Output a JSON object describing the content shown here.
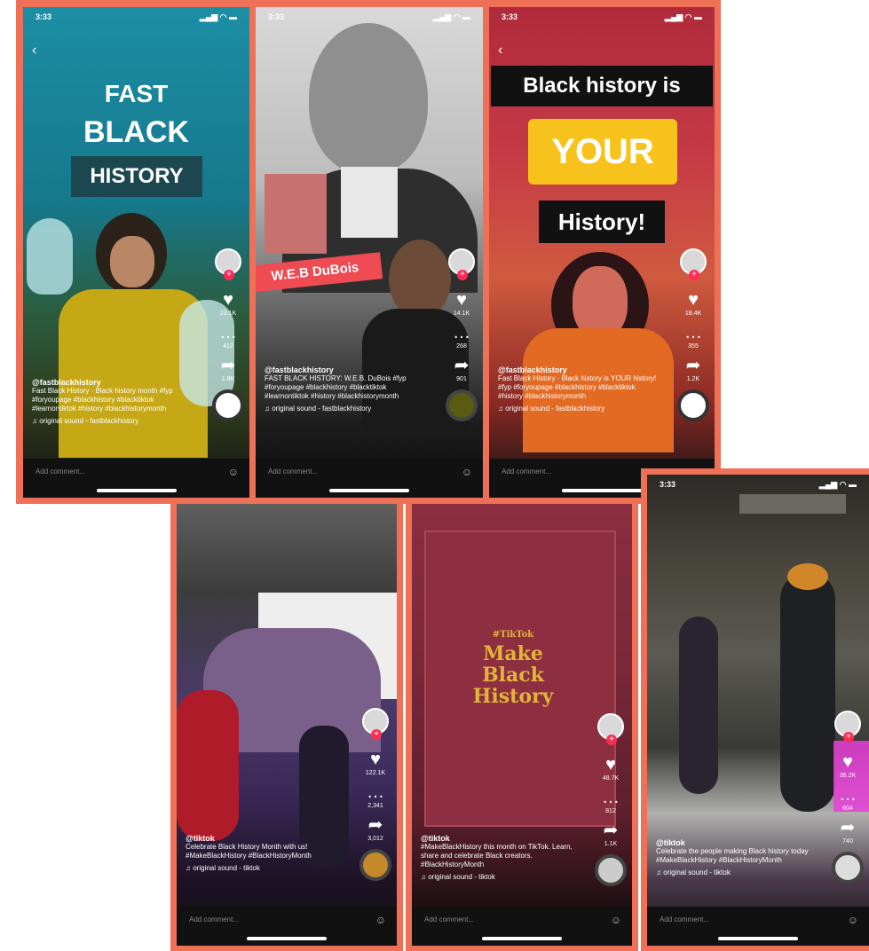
{
  "colors": {
    "frame": "#ee7157",
    "like": "#fe2c55",
    "yellow": "#f8c21c"
  },
  "status": {
    "time": "3:33",
    "signal": "▂▄▆ ◠ ▬"
  },
  "rail": {
    "like": "♥",
    "comment": "…",
    "share": "➦"
  },
  "comment": {
    "placeholder": "Add comment...",
    "at": "@",
    "emoji": "☺"
  },
  "p1": {
    "title_line1": "FAST",
    "title_line2": "BLACK",
    "title_line3": "HISTORY",
    "likes": "23.1K",
    "comments": "412",
    "shares": "1.8K",
    "user": "@fastblackhistory",
    "caption": "Fast Black History · Black history month #fyp #foryoupage #blackhistory #blacktiktok #learnontiktok #history #blackhistorymonth",
    "sound": "♫ original sound - fastblackhistory"
  },
  "p2": {
    "banner": "W.E.B DuBois",
    "likes": "14.1K",
    "comments": "268",
    "shares": "901",
    "user": "@fastblackhistory",
    "caption": "FAST BLACK HISTORY: W.E.B. DuBois #fyp #foryoupage #blackhistory #blacktiktok #learnontiktok #history #blackhistorymonth",
    "sound": "♫ original sound - fastblackhistory"
  },
  "p3": {
    "line1": "Black history is",
    "line2": "YOUR",
    "line3": "History!",
    "likes": "18.4K",
    "comments": "355",
    "shares": "1.2K",
    "user": "@fastblackhistory",
    "caption": "Fast Black History · Black history is YOUR history! #fyp #foryoupage #blackhistory #blacktiktok #history #blackhistorymonth",
    "sound": "♫ original sound - fastblackhistory"
  },
  "p4": {
    "likes": "122.1K",
    "comments": "2,341",
    "shares": "3,012",
    "user": "@tiktok",
    "caption": "Celebrate Black History Month with us! #MakeBlackHistory #BlackHistoryMonth",
    "sound": "♫ original sound - tiktok"
  },
  "p5": {
    "prefix": "#TikTok",
    "title1": "Make",
    "title2": "Black",
    "title3": "History",
    "likes": "48.7K",
    "comments": "812",
    "shares": "1.1K",
    "user": "@tiktok",
    "caption": "#MakeBlackHistory this month on TikTok. Learn, share and celebrate Black creators. #BlackHistoryMonth",
    "sound": "♫ original sound - tiktok"
  },
  "p6": {
    "likes": "36.2K",
    "comments": "604",
    "shares": "740",
    "user": "@tiktok",
    "caption": "Celebrate the people making Black history today #MakeBlackHistory #BlackHistoryMonth",
    "sound": "♫ original sound - tiktok"
  }
}
